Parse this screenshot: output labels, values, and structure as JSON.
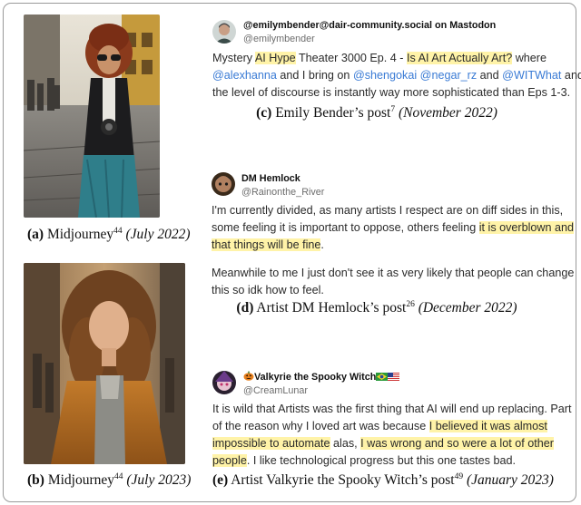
{
  "figure": {
    "a": {
      "letter": "(a)",
      "text": "Midjourney",
      "ref": "44",
      "date": "(July 2022)"
    },
    "b": {
      "letter": "(b)",
      "text": "Midjourney",
      "ref": "44",
      "date": "(July 2023)"
    },
    "c": {
      "letter": "(c)",
      "text": "Emily Bender’s post",
      "ref": "7",
      "date": "(November 2022)",
      "user": "@emilymbender@dair-community.social on Mastodon",
      "handle": "@emilymbender",
      "line1": [
        "Mystery ",
        "AI Hype",
        " Theater 3000 Ep. 4 - ",
        "Is AI Art Actually Art?",
        " where"
      ],
      "line2": [
        "@alexhanna",
        " and I bring on ",
        "@shengokai",
        " ",
        "@negar_rz",
        " and ",
        "@WITWhat",
        " and"
      ],
      "line3": "the level of discourse is instantly way more sophisticated than Eps 1-3."
    },
    "d": {
      "letter": "(d)",
      "text": "Artist DM Hemlock’s post",
      "ref": "26",
      "date": "(December 2022)",
      "user": "DM Hemlock",
      "handle": "@Rainonthe_River",
      "line1": "I'm currently divided,  as many artists I respect are on diff sides in this,",
      "line2": [
        "some feeling it is important to oppose, others feeling ",
        "it is overblown and"
      ],
      "line3": [
        "that things will be fine",
        "."
      ],
      "line4": "Meanwhile to me I just don't see it as very likely that people can change",
      "line5": "this so idk how to feel."
    },
    "e": {
      "letter": "(e)",
      "text": "Artist Valkyrie the Spooky Witch’s post",
      "ref": "49",
      "date": "(January 2023)",
      "user": "Valkyrie the Spooky Witch",
      "handle": "@CreamLunar",
      "line1": "It is wild that Artists was the first thing that AI will end up replacing. Part",
      "line2": [
        "of the reason why I loved art was because ",
        "I believed it was almost"
      ],
      "line3": [
        "impossible to automate",
        " alas, ",
        "I was wrong and so were a lot of other"
      ],
      "line4": [
        "people",
        ". I like technological progress but this one tastes bad."
      ]
    }
  },
  "colors": {
    "highlight": "#fff3a8",
    "link": "#3a7bd5",
    "border": "#9a9a9a"
  },
  "icons": [
    "pumpkin-icon",
    "brazil-flag-icon",
    "us-flag-icon"
  ]
}
